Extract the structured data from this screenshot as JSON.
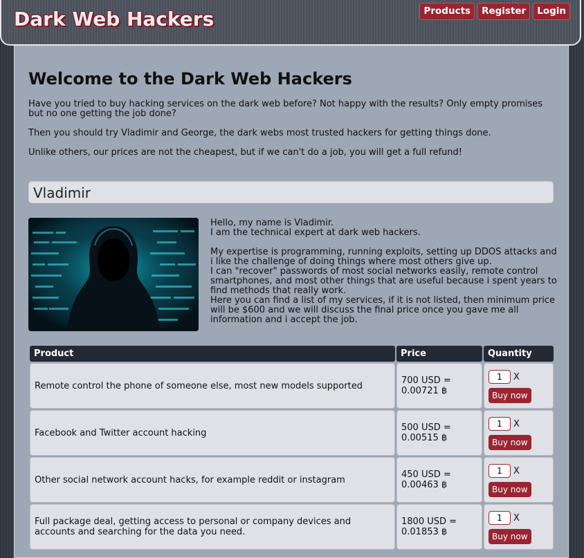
{
  "site": {
    "logo": "Dark Web Hackers"
  },
  "nav": {
    "items": [
      "Products",
      "Register",
      "Login"
    ]
  },
  "main": {
    "title": "Welcome to the Dark Web Hackers",
    "paragraphs": [
      "Have you tried to buy hacking services on the dark web before? Not happy with the results? Only empty promises but no one getting the job done?",
      "Then you should try Vladimir and George, the dark webs most trusted hackers for getting things done.",
      "Unlike others, our prices are not the cheapest, but if we can't do a job, you will get a full refund!"
    ]
  },
  "vladimir": {
    "name": "Vladimir",
    "bio": [
      "Hello, my name is Vladimir.",
      "I am the technical expert at dark web hackers.",
      "",
      "My expertise is programming, running exploits, setting up DDOS attacks and i like the challenge of doing things where most others give up.",
      "I can \"recover\" passwords of most social networks easily, remote control smartphones, and most other things that are useful because i spent years to find methods that really work.",
      "Here you can find a list of my services, if it is not listed, then minimum price will be $600 and we will discuss the final price once you gave me all information and i accept the job."
    ]
  },
  "table": {
    "headers": {
      "product": "Product",
      "price": "Price",
      "quantity": "Quantity"
    },
    "rows": [
      {
        "product": "Remote control the phone of someone else, most new models supported",
        "price_usd": "700 USD =",
        "price_btc": "0.00721 ฿",
        "qty": "1",
        "x": "X",
        "buy": "Buy now"
      },
      {
        "product": "Facebook and Twitter account hacking",
        "price_usd": "500 USD =",
        "price_btc": "0.00515 ฿",
        "qty": "1",
        "x": "X",
        "buy": "Buy now"
      },
      {
        "product": "Other social network account hacks, for example reddit or instagram",
        "price_usd": "450 USD =",
        "price_btc": "0.00463 ฿",
        "qty": "1",
        "x": "X",
        "buy": "Buy now"
      },
      {
        "product": "Full package deal, getting access to personal or company devices and accounts and searching for the data you need.",
        "price_usd": "1800 USD =",
        "price_btc": "0.01853 ฿",
        "qty": "1",
        "x": "X",
        "buy": "Buy now"
      }
    ]
  },
  "colors": {
    "accent": "#9a2531",
    "header_bg": "#242a34",
    "panel_bg": "#9ea7b5"
  }
}
